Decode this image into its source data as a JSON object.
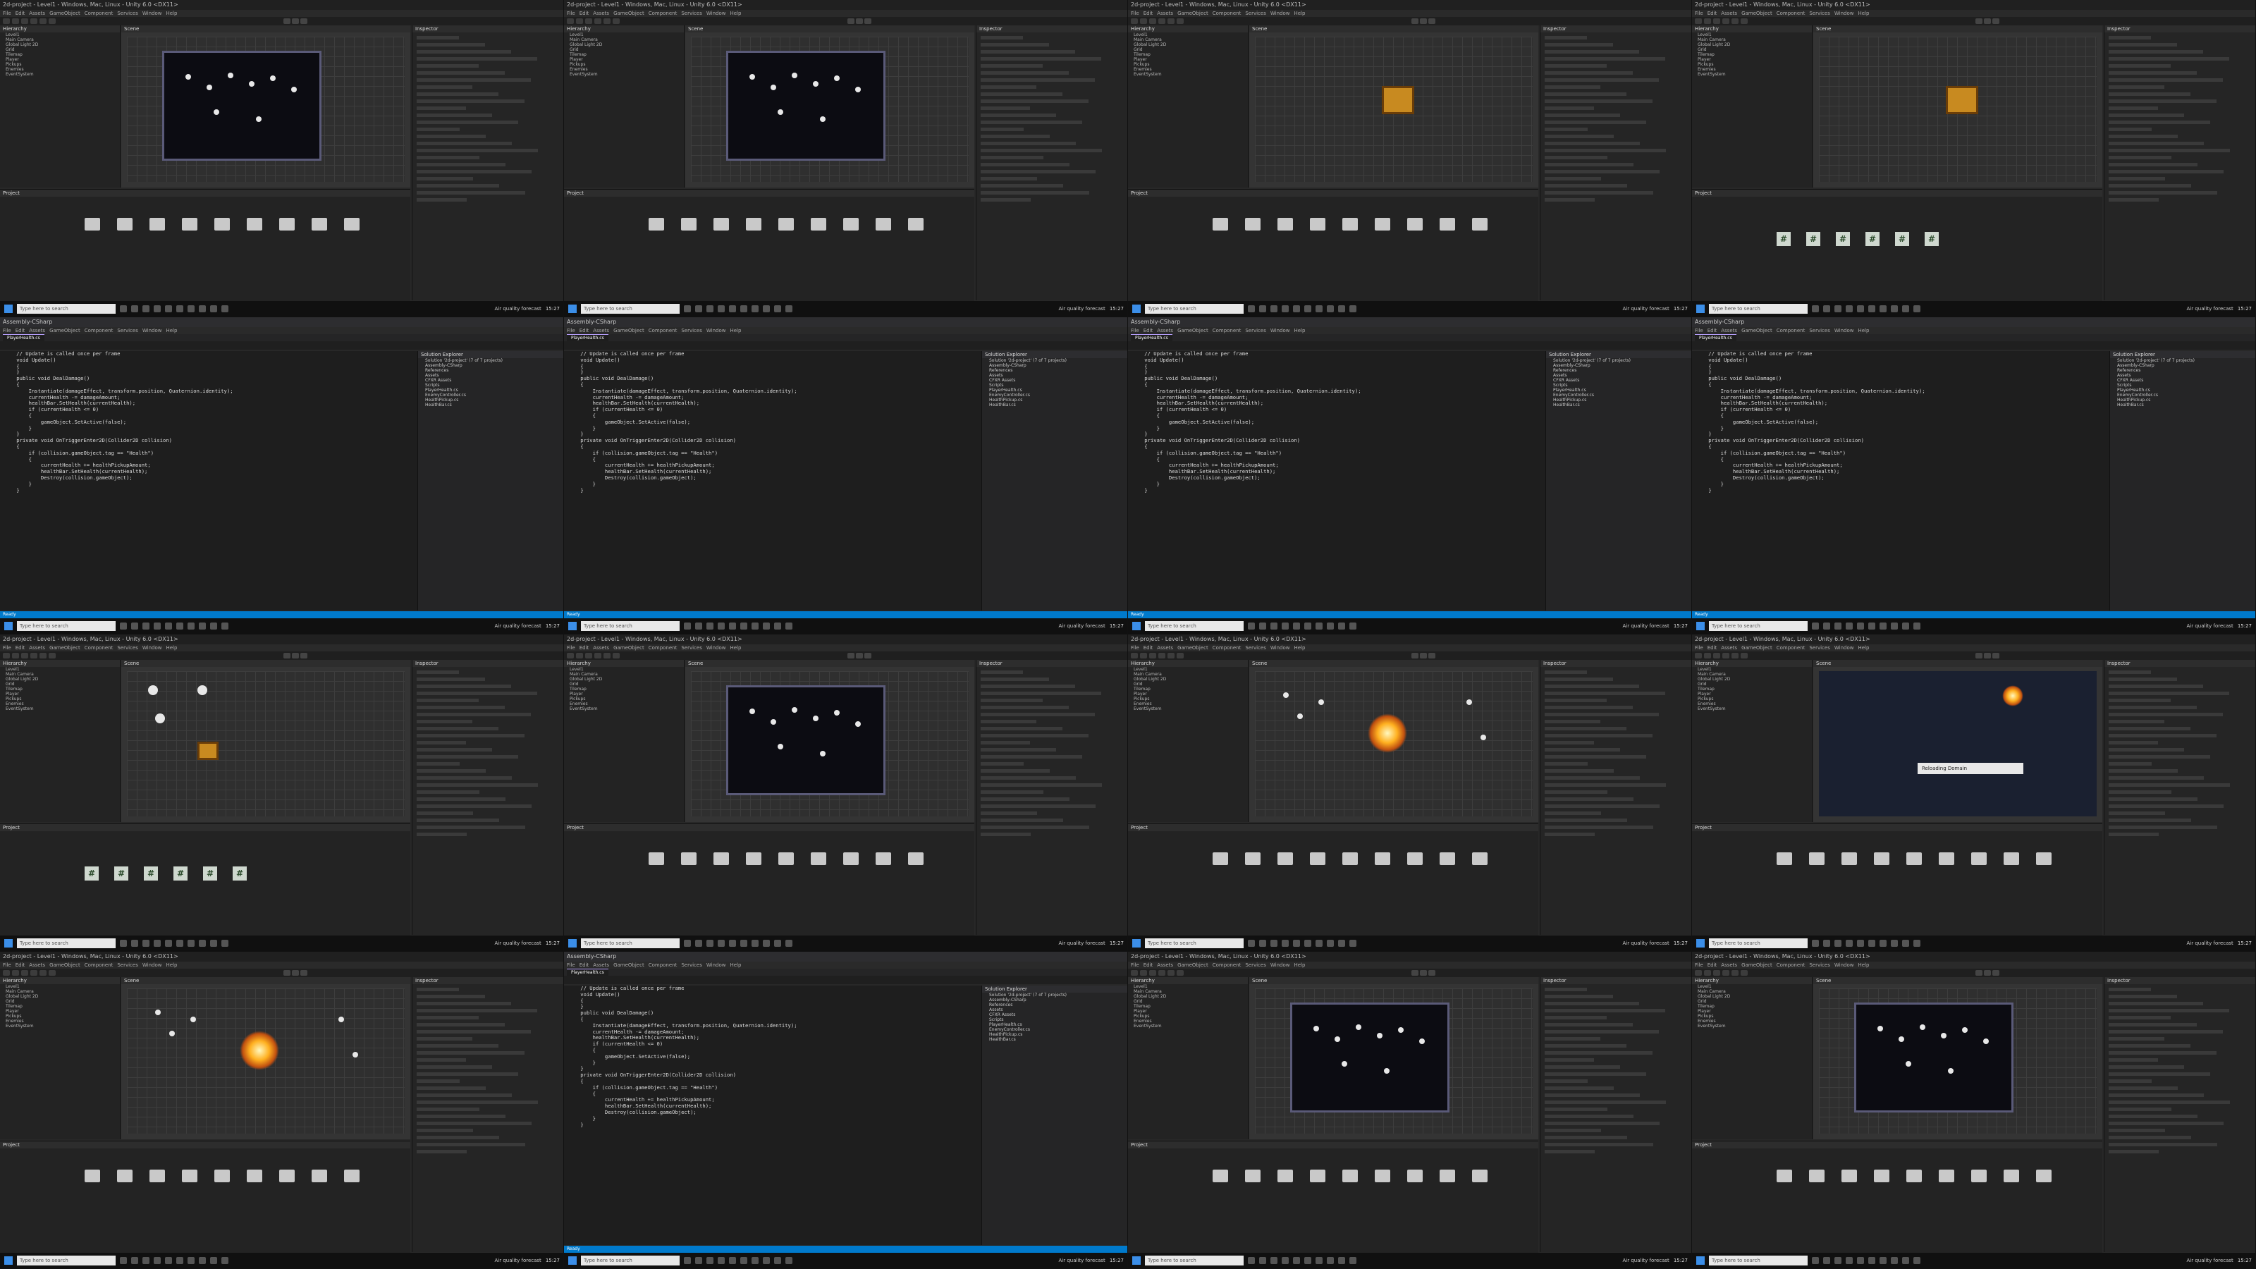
{
  "windows": [
    {
      "type": "unity",
      "title": "2d-project - Level1 - Windows, Mac, Linux - Unity 6.0 <DX11>",
      "hierarchy_title": "Hierarchy",
      "scene_tab": "Scene",
      "project_tab": "Project",
      "inspector_tab": "Inspector",
      "view": "level"
    },
    {
      "type": "unity",
      "title": "2d-project - Level1 - Windows, Mac, Linux - Unity 6.0 <DX11>",
      "hierarchy_title": "Hierarchy",
      "scene_tab": "Scene",
      "project_tab": "Project",
      "inspector_tab": "Inspector",
      "view": "level"
    },
    {
      "type": "unity",
      "title": "2d-project - Level1 - Windows, Mac, Linux - Unity 6.0 <DX11>",
      "hierarchy_title": "Hierarchy",
      "scene_tab": "Scene",
      "project_tab": "Project",
      "inspector_tab": "Inspector",
      "view": "chest"
    },
    {
      "type": "unity",
      "title": "2d-project - Level1 - Windows, Mac, Linux - Unity 6.0 <DX11>",
      "hierarchy_title": "Hierarchy",
      "scene_tab": "Scene",
      "project_tab": "Project",
      "inspector_tab": "Inspector",
      "view": "chest"
    },
    {
      "type": "vs",
      "title": "Assembly-CSharp",
      "file_tab": "PlayerHealth.cs"
    },
    {
      "type": "vs",
      "title": "Assembly-CSharp",
      "file_tab": "PlayerHealth.cs"
    },
    {
      "type": "vs",
      "title": "Assembly-CSharp",
      "file_tab": "PlayerHealth.cs"
    },
    {
      "type": "vs",
      "title": "Assembly-CSharp",
      "file_tab": "PlayerHealth.cs"
    },
    {
      "type": "unity",
      "title": "2d-project - Level1 - Windows, Mac, Linux - Unity 6.0 <DX11>",
      "hierarchy_title": "Hierarchy",
      "scene_tab": "Scene",
      "project_tab": "Project",
      "inspector_tab": "Inspector",
      "view": "icons"
    },
    {
      "type": "unity",
      "title": "2d-project - Level1 - Windows, Mac, Linux - Unity 6.0 <DX11>",
      "hierarchy_title": "Hierarchy",
      "scene_tab": "Scene",
      "project_tab": "Project",
      "inspector_tab": "Inspector",
      "view": "level"
    },
    {
      "type": "unity",
      "title": "2d-project - Level1 - Windows, Mac, Linux - Unity 6.0 <DX11>",
      "hierarchy_title": "Hierarchy",
      "scene_tab": "Scene",
      "project_tab": "Project",
      "inspector_tab": "Inspector",
      "view": "burst"
    },
    {
      "type": "unity",
      "title": "2d-project - Level1 - Windows, Mac, Linux - Unity 6.0 <DX11>",
      "hierarchy_title": "Hierarchy",
      "scene_tab": "Scene",
      "project_tab": "Project",
      "inspector_tab": "Inspector",
      "view": "game"
    },
    {
      "type": "unity",
      "title": "2d-project - Level1 - Windows, Mac, Linux - Unity 6.0 <DX11>",
      "hierarchy_title": "Hierarchy",
      "scene_tab": "Scene",
      "project_tab": "Project",
      "inspector_tab": "Inspector",
      "view": "burst"
    },
    {
      "type": "vs",
      "title": "Assembly-CSharp",
      "file_tab": "PlayerHealth.cs"
    },
    {
      "type": "unity",
      "title": "2d-project - Level1 - Windows, Mac, Linux - Unity 6.0 <DX11>",
      "hierarchy_title": "Hierarchy",
      "scene_tab": "Scene",
      "project_tab": "Project",
      "inspector_tab": "Inspector",
      "view": "level"
    },
    {
      "type": "unity",
      "title": "2d-project - Level1 - Windows, Mac, Linux - Unity 6.0 <DX11>",
      "hierarchy_title": "Hierarchy",
      "scene_tab": "Scene",
      "project_tab": "Project",
      "inspector_tab": "Inspector",
      "view": "level"
    }
  ],
  "menu_items": [
    "File",
    "Edit",
    "Assets",
    "GameObject",
    "Component",
    "Services",
    "Window",
    "Help"
  ],
  "hierarchy_rows": [
    "Level1",
    "Main Camera",
    "Global Light 2D",
    "Grid",
    "Tilemap",
    "Player",
    "Pickups",
    "Enemies",
    "EventSystem"
  ],
  "inspector_header": "Inspector",
  "code_lines": [
    "    // Update is called once per frame",
    "    void Update()",
    "    {",
    "    }",
    "",
    "    public void DealDamage()",
    "    {",
    "        Instantiate(damageEffect, transform.position, Quaternion.identity);",
    "        currentHealth -= damageAmount;",
    "",
    "        healthBar.SetHealth(currentHealth);",
    "",
    "        if (currentHealth <= 0)",
    "        {",
    "            gameObject.SetActive(false);",
    "        }",
    "    }",
    "",
    "    private void OnTriggerEnter2D(Collider2D collision)",
    "    {",
    "        if (collision.gameObject.tag == \"Health\")",
    "        {",
    "            currentHealth += healthPickupAmount;",
    "            healthBar.SetHealth(currentHealth);",
    "            Destroy(collision.gameObject);",
    "        }",
    "    }"
  ],
  "solution_header": "Solution Explorer",
  "solution_rows": [
    "Solution '2d-project' (7 of 7 projects)",
    "Assembly-CSharp",
    "References",
    "Assets",
    "CFXR Assets",
    "Scripts",
    "PlayerHealth.cs",
    "EnemyController.cs",
    "HealthPickup.cs",
    "HealthBar.cs"
  ],
  "status_text": "Ready",
  "taskbar": {
    "search_placeholder": "Type here to search",
    "weather": "Air quality forecast",
    "time": "15:27"
  },
  "project_folders": [
    "Animations",
    "Art",
    "Audio",
    "Materials",
    "Prefabs",
    "Scenes",
    "Scripts",
    "Settings",
    "Tiles"
  ],
  "script_icon": "#",
  "dialog_text": "Reloading Domain"
}
